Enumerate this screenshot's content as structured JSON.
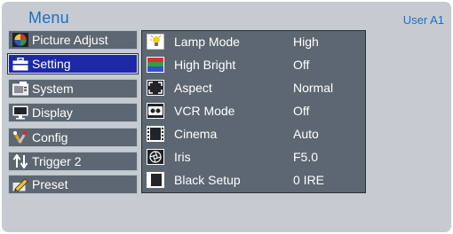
{
  "header": {
    "title": "Menu",
    "user": "User A1"
  },
  "left_menu": [
    {
      "label": "Picture Adjust",
      "icon": "color-circles-icon",
      "selected": false
    },
    {
      "label": "Setting",
      "icon": "toolbox-icon",
      "selected": true
    },
    {
      "label": "System",
      "icon": "system-icon",
      "selected": false
    },
    {
      "label": "Display",
      "icon": "monitor-icon",
      "selected": false
    },
    {
      "label": "Config",
      "icon": "tools-icon",
      "selected": false
    },
    {
      "label": "Trigger 2",
      "icon": "trigger-arrows-icon",
      "selected": false
    },
    {
      "label": "Preset",
      "icon": "pencil-icon",
      "selected": false
    }
  ],
  "settings": [
    {
      "label": "Lamp Mode",
      "value": "High",
      "icon": "lamp-icon"
    },
    {
      "label": "High Bright",
      "value": "Off",
      "icon": "rgb-bars-icon"
    },
    {
      "label": "Aspect",
      "value": "Normal",
      "icon": "aspect-icon"
    },
    {
      "label": "VCR Mode",
      "value": "Off",
      "icon": "vcr-icon"
    },
    {
      "label": "Cinema",
      "value": "Auto",
      "icon": "film-icon"
    },
    {
      "label": "Iris",
      "value": "F5.0",
      "icon": "iris-icon"
    },
    {
      "label": "Black Setup",
      "value": "0 IRE",
      "icon": "black-setup-icon"
    }
  ],
  "colors": {
    "background": "#c6cbd1",
    "panel": "#5d6772",
    "selected": "#1c28a8",
    "accent_text": "#1d6fc2"
  }
}
